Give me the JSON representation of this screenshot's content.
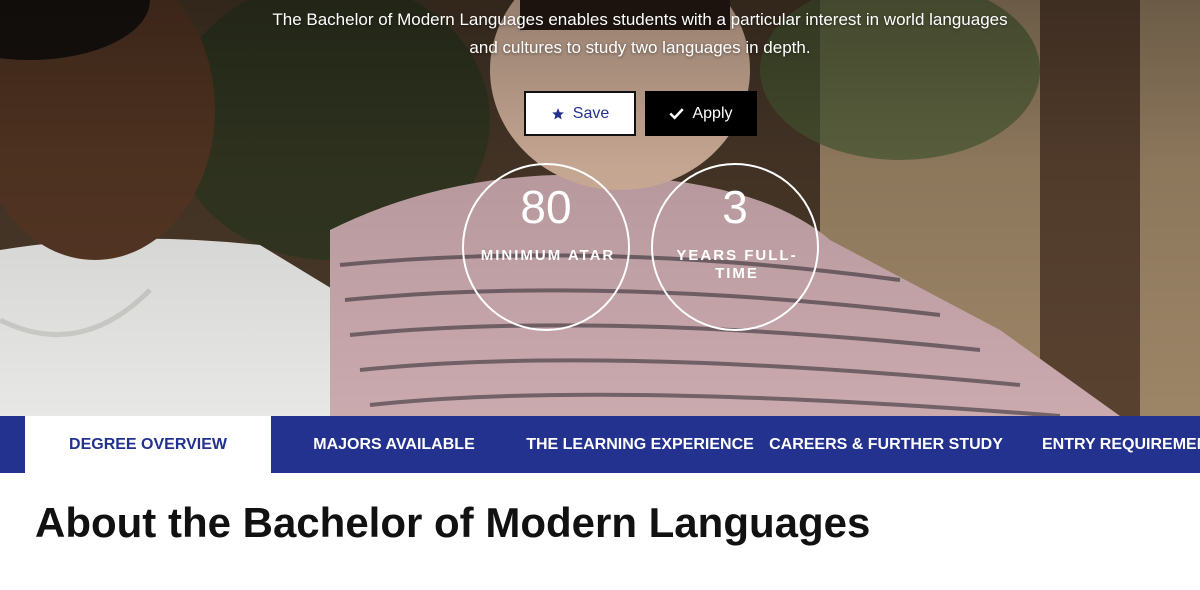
{
  "hero": {
    "description": "The Bachelor of Modern Languages enables students with a particular interest in world languages and cultures to study two languages in depth.",
    "save_label": "Save",
    "apply_label": "Apply",
    "stats": [
      {
        "value": "80",
        "label": "MINIMUM ATAR"
      },
      {
        "value": "3",
        "label": "YEARS FULL-TIME"
      }
    ]
  },
  "tabs": [
    {
      "label": "DEGREE OVERVIEW",
      "active": true
    },
    {
      "label": "MAJORS AVAILABLE"
    },
    {
      "label": "THE LEARNING EXPERIENCE"
    },
    {
      "label": "CAREERS & FURTHER STUDY"
    },
    {
      "label": "ENTRY REQUIREMEN"
    }
  ],
  "content": {
    "title": "About the Bachelor of Modern Languages"
  },
  "icons": {
    "save": "star-icon",
    "apply": "check-icon"
  },
  "colors": {
    "brand_blue": "#23318f",
    "white": "#ffffff",
    "black": "#000000"
  }
}
